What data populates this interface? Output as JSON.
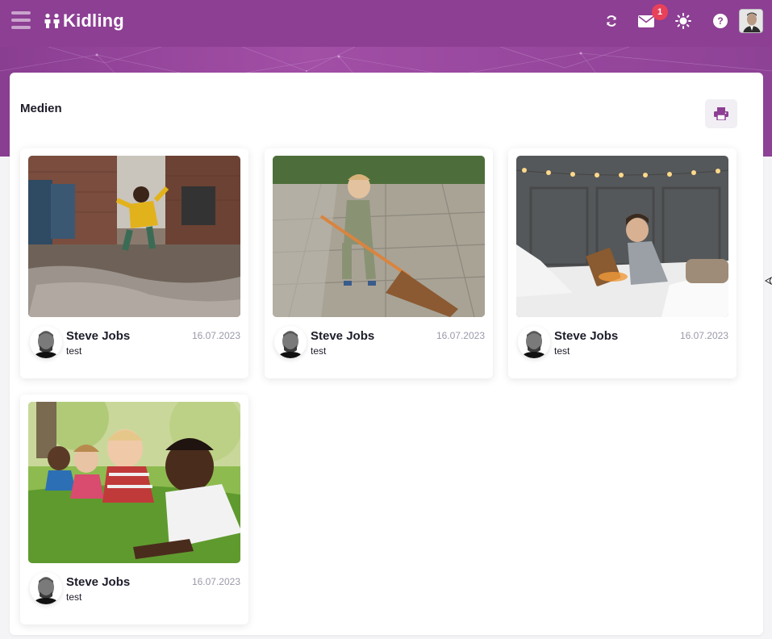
{
  "app": {
    "name": "Kidling",
    "brand_color": "#8c3f93"
  },
  "header": {
    "notifications_count": "1",
    "icons": [
      "menu-icon",
      "refresh-icon",
      "mail-icon",
      "brightness-icon",
      "help-icon",
      "user-avatar"
    ],
    "help_glyph": "?"
  },
  "page": {
    "title": "Medien"
  },
  "media": [
    {
      "author": "Steve Jobs",
      "text": "test",
      "date": "16.07.2023",
      "image": "child-jumping-in-puddle"
    },
    {
      "author": "Steve Jobs",
      "text": "test",
      "date": "16.07.2023",
      "image": "child-with-broom"
    },
    {
      "author": "Steve Jobs",
      "text": "test",
      "date": "16.07.2023",
      "image": "boy-reading-book"
    },
    {
      "author": "Steve Jobs",
      "text": "test",
      "date": "16.07.2023",
      "image": "children-lying-on-grass"
    }
  ]
}
